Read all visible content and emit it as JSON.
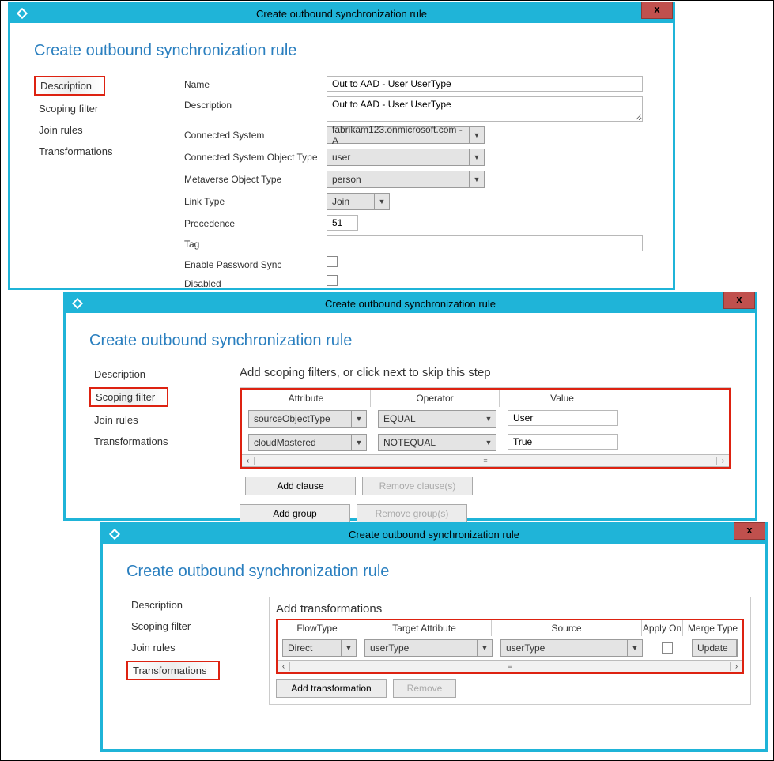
{
  "windows": {
    "title": "Create outbound synchronization rule",
    "close": "x"
  },
  "pageTitle": "Create outbound synchronization rule",
  "sidebar": {
    "description": "Description",
    "scoping": "Scoping filter",
    "join": "Join rules",
    "transformations": "Transformations"
  },
  "descForm": {
    "labels": {
      "name": "Name",
      "description": "Description",
      "connectedSystem": "Connected System",
      "connectedSystemObjType": "Connected System Object Type",
      "metaverseObjType": "Metaverse Object Type",
      "linkType": "Link Type",
      "precedence": "Precedence",
      "tag": "Tag",
      "enablePasswordSync": "Enable Password Sync",
      "disabled": "Disabled"
    },
    "values": {
      "name": "Out to AAD - User UserType",
      "description": "Out to AAD - User UserType",
      "connectedSystem": "fabrikam123.onmicrosoft.com - A",
      "connectedSystemObjType": "user",
      "metaverseObjType": "person",
      "linkType": "Join",
      "precedence": "51",
      "tag": ""
    }
  },
  "scoping": {
    "heading": "Add scoping filters, or click next to skip this step",
    "cols": {
      "attribute": "Attribute",
      "operator": "Operator",
      "value": "Value"
    },
    "rows": [
      {
        "attribute": "sourceObjectType",
        "operator": "EQUAL",
        "value": "User"
      },
      {
        "attribute": "cloudMastered",
        "operator": "NOTEQUAL",
        "value": "True"
      }
    ],
    "buttons": {
      "addClause": "Add clause",
      "removeClause": "Remove clause(s)",
      "addGroup": "Add group",
      "removeGroup": "Remove group(s)"
    }
  },
  "trans": {
    "heading": "Add transformations",
    "cols": {
      "flowType": "FlowType",
      "targetAttr": "Target Attribute",
      "source": "Source",
      "applyOnce": "Apply On",
      "mergeType": "Merge Type"
    },
    "row": {
      "flowType": "Direct",
      "targetAttr": "userType",
      "source": "userType",
      "mergeType": "Update"
    },
    "buttons": {
      "add": "Add transformation",
      "remove": "Remove"
    }
  }
}
